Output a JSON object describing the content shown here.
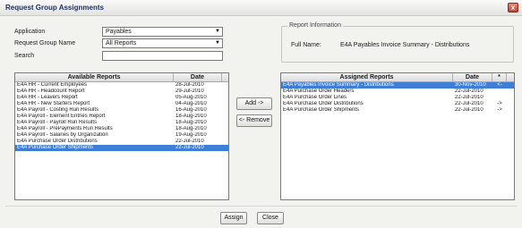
{
  "window": {
    "title": "Request Group Assignments",
    "close_glyph": "x"
  },
  "form": {
    "application_label": "Application",
    "application_value": "Payables",
    "request_group_label": "Request Group Name",
    "request_group_value": "All Reports",
    "search_label": "Search",
    "search_value": ""
  },
  "report_info": {
    "legend": "Report Information",
    "full_name_label": "Full Name:",
    "full_name_value": "E4A Payables Invoice Summary - Distributions"
  },
  "available": {
    "headers": {
      "name": "Available Reports",
      "date": "Date"
    },
    "rows": [
      {
        "name": "E4A HR - Current Employees",
        "date": "28-Jul-2010"
      },
      {
        "name": "E4A HR - Headcount Report",
        "date": "29-Jul-2010"
      },
      {
        "name": "E4A HR - Leavers Report",
        "date": "05-Aug-2010"
      },
      {
        "name": "E4A HR - New Starters Report",
        "date": "04-Aug-2010"
      },
      {
        "name": "E4A Payroll - Costing Run Results",
        "date": "16-Aug-2010"
      },
      {
        "name": "E4A Payroll - Element Entries Report",
        "date": "18-Aug-2010"
      },
      {
        "name": "E4A Payroll - Payroll Run Results",
        "date": "18-Aug-2010"
      },
      {
        "name": "E4A Payroll - PrePayments Run Results",
        "date": "18-Aug-2010"
      },
      {
        "name": "E4A Payroll - Salaries by Organization",
        "date": "19-Aug-2010"
      },
      {
        "name": "E4A Purchase Order Distributions",
        "date": "22-Jul-2010"
      },
      {
        "name": "E4A Purchase Order Shipments",
        "date": "22-Jul-2010"
      }
    ],
    "selected_index": 10
  },
  "assigned": {
    "headers": {
      "name": "Assigned Reports",
      "date": "Date",
      "flag": "*"
    },
    "rows": [
      {
        "name": "E4A Payables Invoice Summary - Distributions",
        "date": "30-Nov-2010",
        "flag": "<-"
      },
      {
        "name": "E4A Purchase Order Headers",
        "date": "22-Jul-2010",
        "flag": ""
      },
      {
        "name": "E4A Purchase Order Lines",
        "date": "22-Jul-2010",
        "flag": ""
      },
      {
        "name": "E4A Purchase Order Distributions",
        "date": "22-Jul-2010",
        "flag": "->"
      },
      {
        "name": "E4A Purchase Order Shipments",
        "date": "22-Jul-2010",
        "flag": "->"
      }
    ],
    "selected_index": 0
  },
  "buttons": {
    "add": "Add ->",
    "remove": "<- Remove",
    "assign": "Assign",
    "close": "Close"
  },
  "colors": {
    "selection": "#3d7fd6",
    "title_text": "#1f2f5e",
    "close_button": "#c4412e"
  }
}
